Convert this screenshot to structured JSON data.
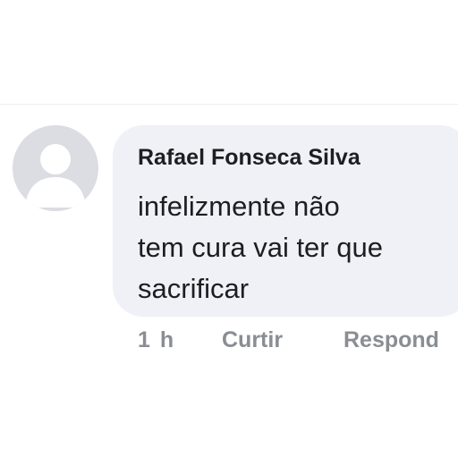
{
  "comment": {
    "author": "Rafael Fonseca Silva",
    "text_lines": [
      "infelizmente não",
      "tem cura vai ter que",
      "sacrificar"
    ],
    "avatar_icon": "default-user-icon"
  },
  "actions": {
    "time": "1 h",
    "like_label": "Curtir",
    "reply_label": "Respond"
  },
  "colors": {
    "bubble": "#f0f1f6",
    "avatar_bg": "#dcdde2",
    "avatar_silhouette": "#ffffff",
    "author_text": "#1c1e21",
    "action_text": "#8a8d93"
  }
}
